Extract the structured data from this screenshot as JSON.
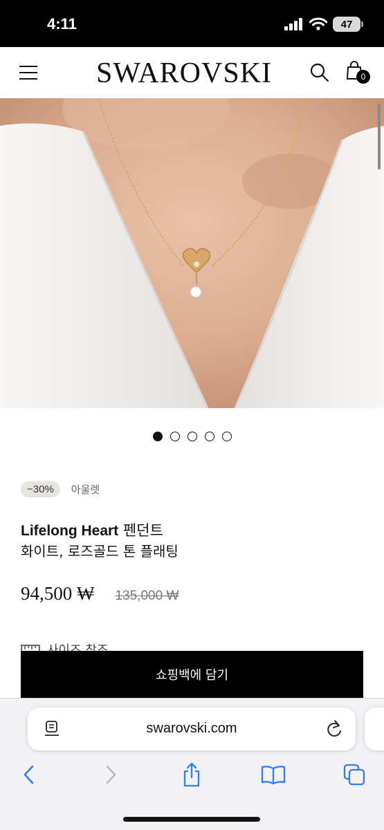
{
  "status_bar": {
    "time": "4:11",
    "battery": "47"
  },
  "header": {
    "logo": "SWAROVSKI",
    "bag_count": "0"
  },
  "carousel": {
    "total": 5,
    "active": 1
  },
  "product": {
    "discount": "−30%",
    "category": "아울렛",
    "name_bold": "Lifelong Heart",
    "name_rest": " 펜던트",
    "subtitle": "화이트, 로즈골드 톤 플래팅",
    "price": "94,500 ₩",
    "original_price": "135,000 ₩",
    "size_guide": "사이즈 참조",
    "add_to_bag": "쇼핑백에 담기"
  },
  "browser": {
    "url": "swarovski.com"
  },
  "colors": {
    "accent": "#000000",
    "badge_bg": "#e6e4df",
    "toolbar_blue": "#2f7cf6"
  }
}
